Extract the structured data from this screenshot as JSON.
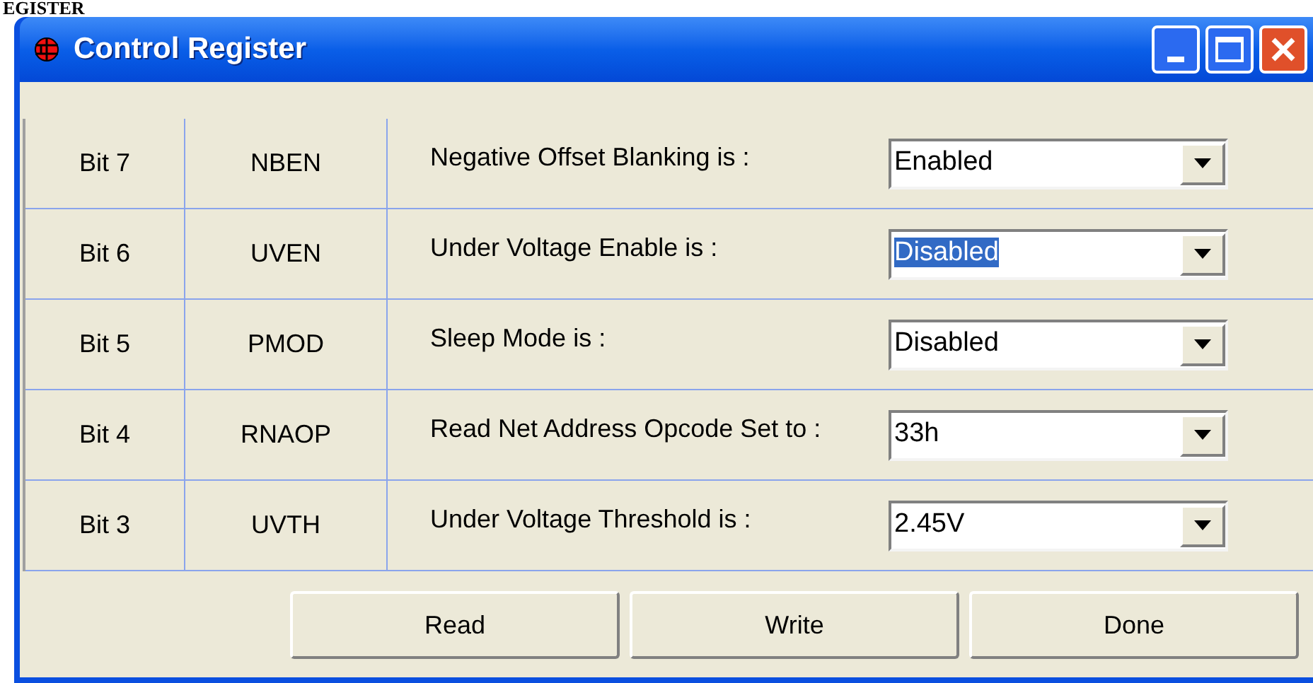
{
  "heading": "EGISTER",
  "window": {
    "title": "Control Register"
  },
  "rows": [
    {
      "bit": "Bit 7",
      "name": "NBEN",
      "label": "Negative Offset Blanking is :",
      "value": "Enabled",
      "highlighted": false
    },
    {
      "bit": "Bit 6",
      "name": "UVEN",
      "label": "Under Voltage Enable is :",
      "value": "Disabled",
      "highlighted": true
    },
    {
      "bit": "Bit 5",
      "name": "PMOD",
      "label": "Sleep Mode is :",
      "value": "Disabled",
      "highlighted": false
    },
    {
      "bit": "Bit 4",
      "name": "RNAOP",
      "label": "Read Net Address Opcode Set to :",
      "value": "33h",
      "highlighted": false
    },
    {
      "bit": "Bit 3",
      "name": "UVTH",
      "label": "Under Voltage Threshold is :",
      "value": "2.45V",
      "highlighted": false
    }
  ],
  "buttons": [
    "Read",
    "Write",
    "Done"
  ]
}
